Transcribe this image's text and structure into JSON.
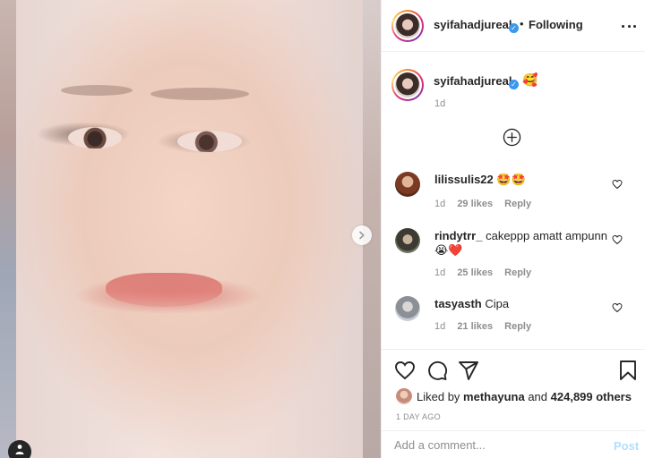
{
  "post": {
    "photo_alt": "",
    "tag_icon": "user-tag-icon",
    "next_icon": "chevron-right-icon"
  },
  "header": {
    "username": "syifahadjureal",
    "verified_icon": "verified-badge-icon",
    "separator": "•",
    "follow_status": "Following",
    "more_icon": "more-horizontal-icon"
  },
  "caption": {
    "username": "syifahadjureal",
    "text": "🥰",
    "time": "1d",
    "load_more_icon": "plus-circle-icon"
  },
  "comments": [
    {
      "username": "lilissulis22",
      "text": "🤩🤩",
      "time": "1d",
      "likes": "29 likes",
      "reply": "Reply"
    },
    {
      "username": "rindytrr_",
      "text": "cakeppp amatt ampunn 😭❤️",
      "time": "1d",
      "likes": "25 likes",
      "reply": "Reply"
    },
    {
      "username": "tasyasth",
      "text": "Cipa",
      "time": "1d",
      "likes": "21 likes",
      "reply": "Reply"
    }
  ],
  "actions": {
    "like_icon": "heart-icon",
    "comment_icon": "comment-icon",
    "share_icon": "send-icon",
    "save_icon": "bookmark-icon",
    "liked_by_prefix": "Liked by",
    "liked_by_user": "methayuna",
    "liked_by_and": "and",
    "liked_by_count": "424,899 others",
    "date": "1 DAY AGO"
  },
  "comment_box": {
    "placeholder": "Add a comment...",
    "post_label": "Post"
  },
  "colors": {
    "accent": "#3897f0",
    "post_disabled": "#b2dffc",
    "text": "#262626",
    "muted": "#8e8e8e"
  }
}
